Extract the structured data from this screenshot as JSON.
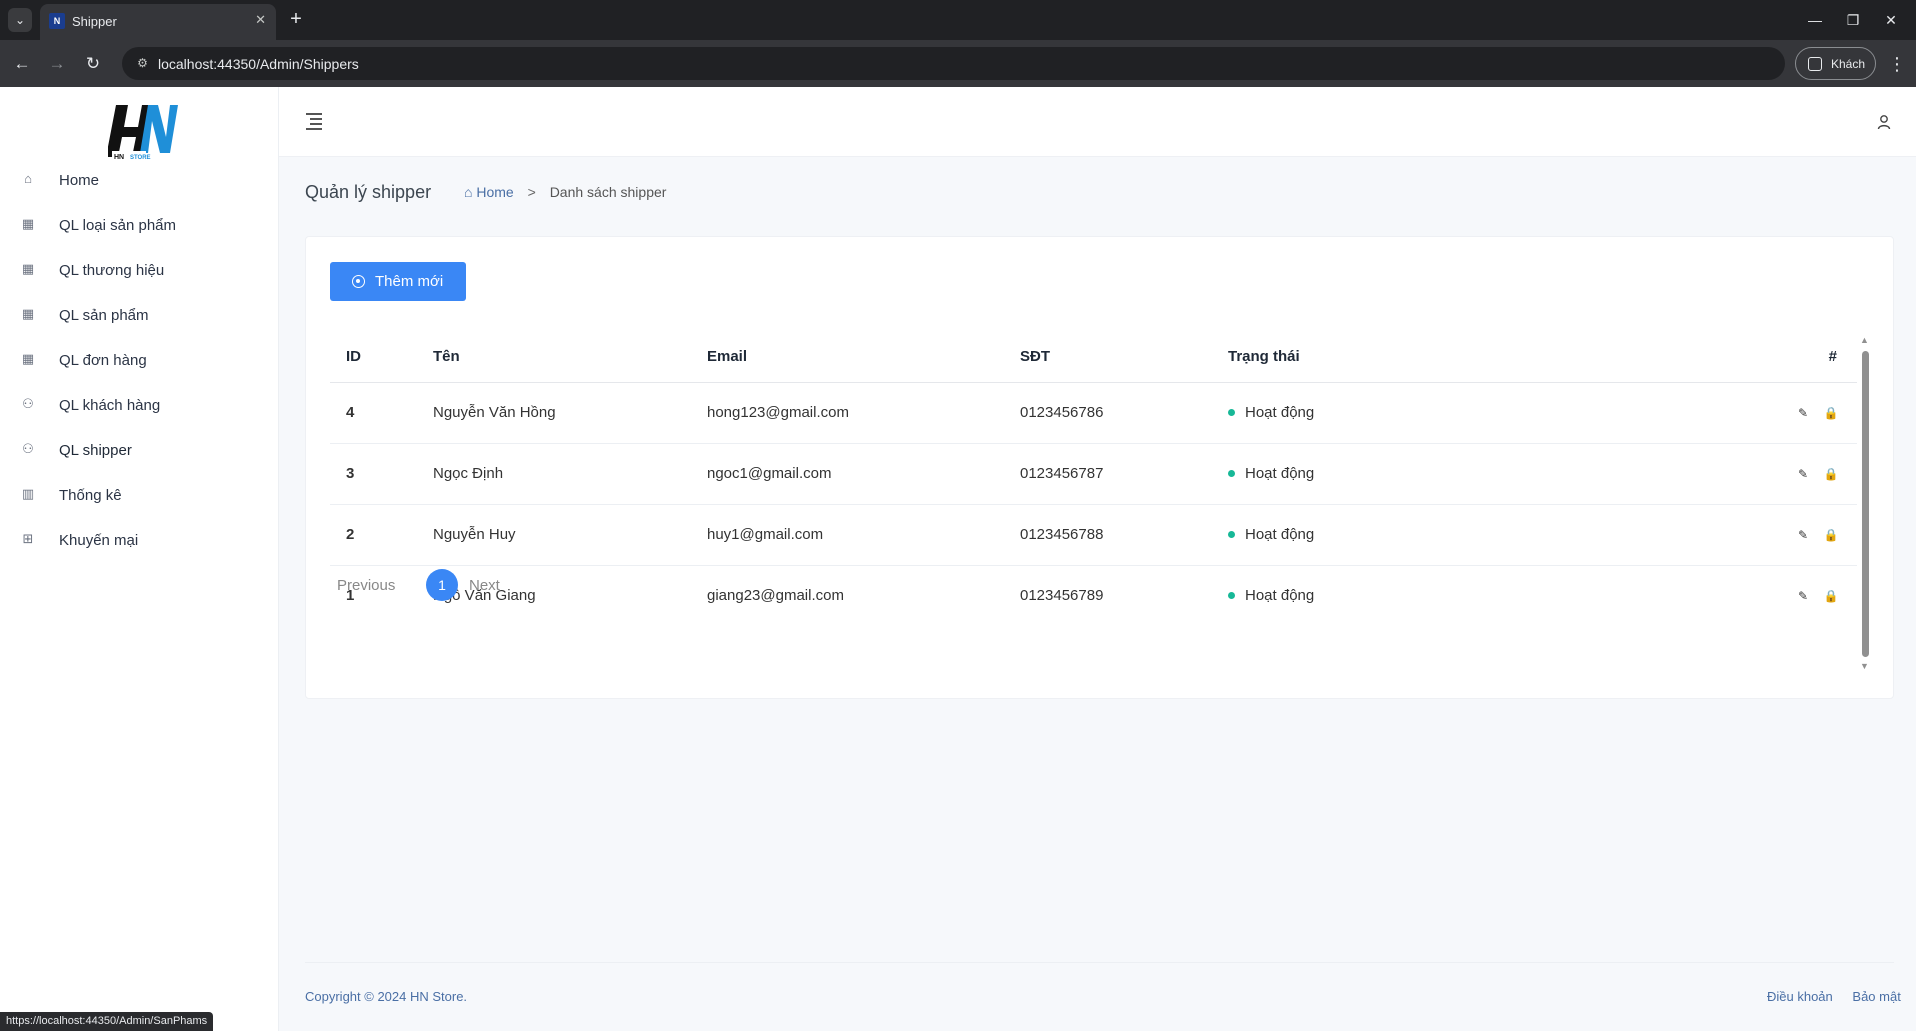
{
  "browser": {
    "tab_title": "Shipper",
    "url": "localhost:44350/Admin/Shippers",
    "profile_label": "Khách",
    "status_url": "https://localhost:44350/Admin/SanPhams"
  },
  "brand": {
    "logo_alt": "HN STORE",
    "accent_color": "#3a87f5",
    "status_color": "#17b897"
  },
  "sidebar": {
    "items": [
      {
        "label": "Home",
        "icon": "home-icon"
      },
      {
        "label": "QL loại sản phẩm",
        "icon": "grid-icon"
      },
      {
        "label": "QL thương hiệu",
        "icon": "grid-icon"
      },
      {
        "label": "QL sản phẩm",
        "icon": "grid-icon"
      },
      {
        "label": "QL đơn hàng",
        "icon": "grid-icon"
      },
      {
        "label": "QL khách hàng",
        "icon": "user-icon"
      },
      {
        "label": "QL shipper",
        "icon": "user-icon"
      },
      {
        "label": "Thống kê",
        "icon": "bar-chart-icon"
      },
      {
        "label": "Khuyến mại",
        "icon": "gift-icon"
      }
    ]
  },
  "page": {
    "title": "Quản lý shipper",
    "breadcrumb_home": "Home",
    "breadcrumb_current": "Danh sách shipper",
    "add_button": "Thêm mới"
  },
  "table": {
    "headers": [
      "ID",
      "Tên",
      "Email",
      "SĐT",
      "Trạng thái",
      "#"
    ],
    "rows": [
      {
        "id": "4",
        "name": "Nguyễn Văn Hồng",
        "email": "hong123@gmail.com",
        "phone": "0123456786",
        "status": "Hoạt động"
      },
      {
        "id": "3",
        "name": "Ngọc Định",
        "email": "ngoc1@gmail.com",
        "phone": "0123456787",
        "status": "Hoạt động"
      },
      {
        "id": "2",
        "name": "Nguyễn Huy",
        "email": "huy1@gmail.com",
        "phone": "0123456788",
        "status": "Hoạt động"
      },
      {
        "id": "1",
        "name": "Ngô Văn Giang",
        "email": "giang23@gmail.com",
        "phone": "0123456789",
        "status": "Hoạt động"
      }
    ]
  },
  "pagination": {
    "previous": "Previous",
    "current": "1",
    "next": "Next"
  },
  "footer": {
    "copyright": "Copyright © 2024 HN Store.",
    "link_terms": "Điều khoản",
    "link_privacy": "Bảo mật"
  }
}
